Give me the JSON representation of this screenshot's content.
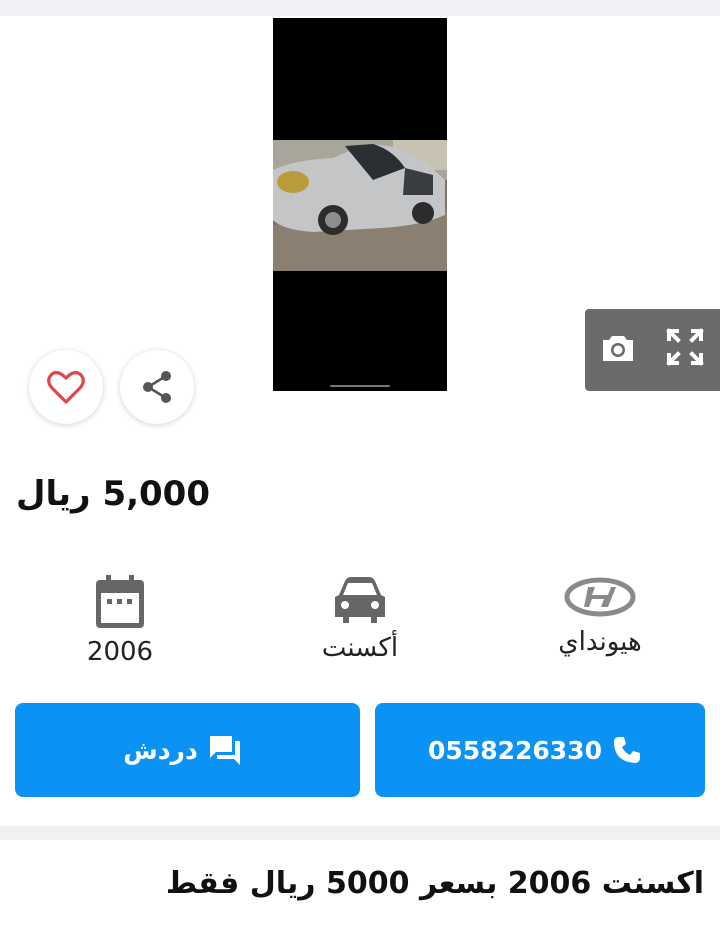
{
  "listing": {
    "price_value": "5,000",
    "price_currency": "ريال",
    "description": "اكسنت 2006 بسعر 5000 ريال فقط"
  },
  "specs": {
    "year": "2006",
    "model": "أكسنت",
    "brand": "هيونداي"
  },
  "actions": {
    "chat_label": "دردش",
    "phone_number": "0558226330"
  },
  "icons": {
    "favorite": "heart-outline-icon",
    "share": "share-icon",
    "camera": "camera-icon",
    "fullscreen": "expand-icon",
    "year": "calendar-icon",
    "model": "car-icon",
    "brand": "hyundai-logo-icon",
    "chat": "chat-icon",
    "call": "phone-icon"
  },
  "colors": {
    "accent": "#0a93f5",
    "heart": "#e0474c",
    "page_gray": "#f0f0f5"
  }
}
